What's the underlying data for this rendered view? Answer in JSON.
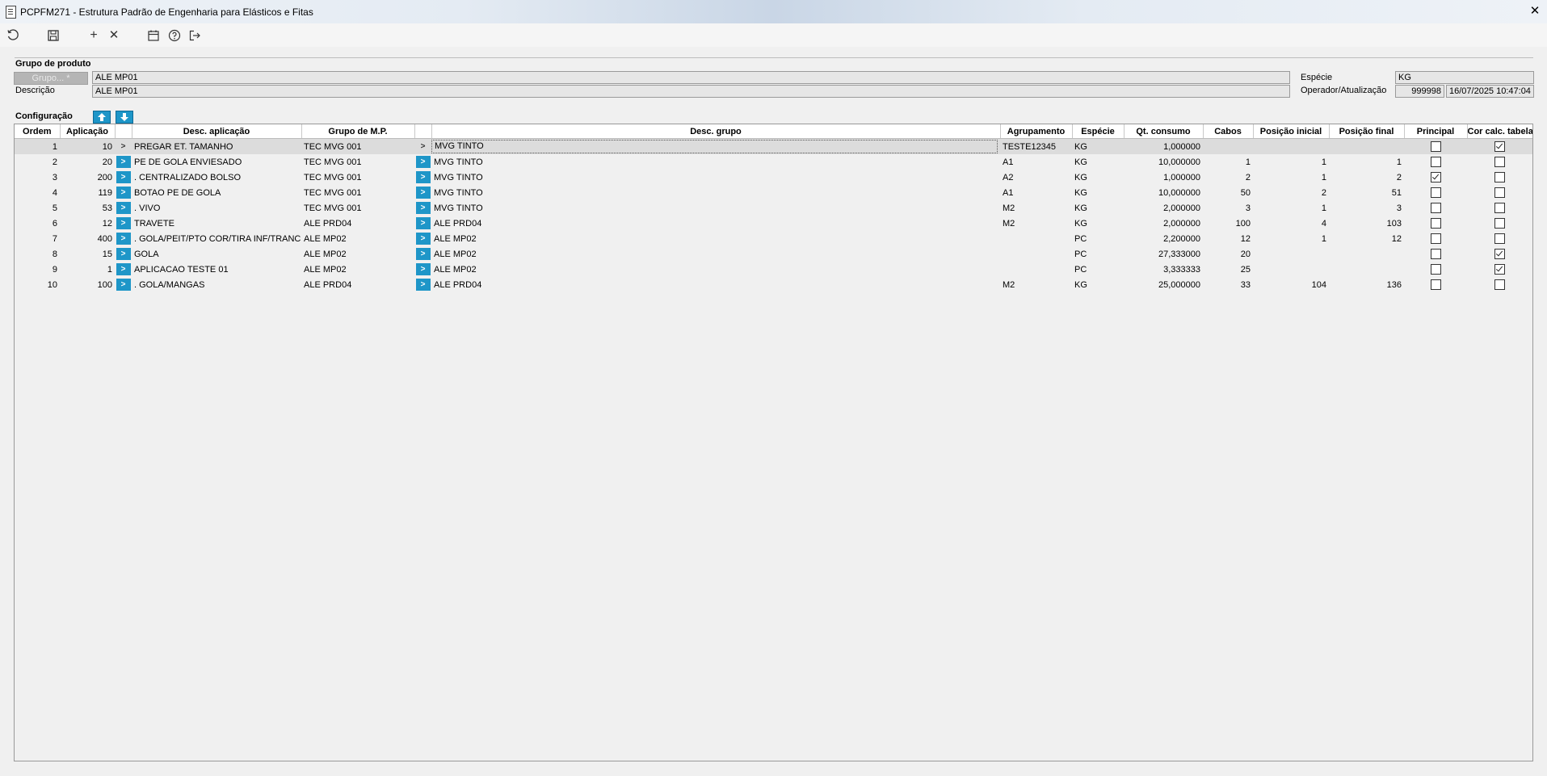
{
  "window": {
    "title": "PCPFM271 - Estrutura Padrão de Engenharia para Elásticos e Fitas",
    "close_glyph": "✕"
  },
  "toolbar": {
    "add_glyph": "+",
    "delete_glyph": "✕"
  },
  "header": {
    "section_label": "Grupo de produto",
    "grupo_button": "Grupo... *",
    "grupo_value": "ALE MP01",
    "descricao_label": "Descrição",
    "descricao_value": "ALE MP01",
    "especie_label": "Espécie",
    "especie_value": "KG",
    "operador_label": "Operador/Atualização",
    "operador_value": "999998",
    "atualizacao_value": "16/07/2025 10:47:04"
  },
  "config": {
    "label": "Configuração"
  },
  "grid": {
    "columns": [
      "Ordem",
      "Aplicação",
      "",
      "Desc. aplicação",
      "Grupo de M.P.",
      "",
      "Desc. grupo",
      "Agrupamento",
      "Espécie",
      "Qt. consumo",
      "Cabos",
      "Posição inicial",
      "Posição final",
      "Principal",
      "Cor calc. tabela"
    ],
    "row_button_label": ">",
    "rows": [
      {
        "ordem": "1",
        "aplicacao": "10",
        "desc_aplicacao": "PREGAR ET. TAMANHO",
        "grupo_mp": "TEC MVG 001",
        "desc_grupo": "MVG TINTO",
        "agrupamento": "TESTE12345",
        "especie": "KG",
        "qt_consumo": "1,000000",
        "cabos": "",
        "pos_inicial": "",
        "pos_final": "",
        "principal": false,
        "cor_calc": true,
        "selected": true
      },
      {
        "ordem": "2",
        "aplicacao": "20",
        "desc_aplicacao": "PE DE GOLA ENVIESADO",
        "grupo_mp": "TEC MVG 001",
        "desc_grupo": "MVG TINTO",
        "agrupamento": "A1",
        "especie": "KG",
        "qt_consumo": "10,000000",
        "cabos": "1",
        "pos_inicial": "1",
        "pos_final": "1",
        "principal": false,
        "cor_calc": false
      },
      {
        "ordem": "3",
        "aplicacao": "200",
        "desc_aplicacao": ". CENTRALIZADO BOLSO",
        "grupo_mp": "TEC MVG 001",
        "desc_grupo": "MVG TINTO",
        "agrupamento": "A2",
        "especie": "KG",
        "qt_consumo": "1,000000",
        "cabos": "2",
        "pos_inicial": "1",
        "pos_final": "2",
        "principal": true,
        "cor_calc": false
      },
      {
        "ordem": "4",
        "aplicacao": "119",
        "desc_aplicacao": "BOTAO PE DE GOLA",
        "grupo_mp": "TEC MVG 001",
        "desc_grupo": "MVG TINTO",
        "agrupamento": "A1",
        "especie": "KG",
        "qt_consumo": "10,000000",
        "cabos": "50",
        "pos_inicial": "2",
        "pos_final": "51",
        "principal": false,
        "cor_calc": false
      },
      {
        "ordem": "5",
        "aplicacao": "53",
        "desc_aplicacao": ". VIVO",
        "grupo_mp": "TEC MVG 001",
        "desc_grupo": "MVG TINTO",
        "agrupamento": "M2",
        "especie": "KG",
        "qt_consumo": "2,000000",
        "cabos": "3",
        "pos_inicial": "1",
        "pos_final": "3",
        "principal": false,
        "cor_calc": false
      },
      {
        "ordem": "6",
        "aplicacao": "12",
        "desc_aplicacao": "TRAVETE",
        "grupo_mp": "ALE PRD04",
        "desc_grupo": "ALE PRD04",
        "agrupamento": "M2",
        "especie": "KG",
        "qt_consumo": "2,000000",
        "cabos": "100",
        "pos_inicial": "4",
        "pos_final": "103",
        "principal": false,
        "cor_calc": false
      },
      {
        "ordem": "7",
        "aplicacao": "400",
        "desc_aplicacao": ". GOLA/PEIT/PTO COR/TIRA INF/TRANC PU",
        "grupo_mp": "ALE MP02",
        "desc_grupo": "ALE MP02",
        "agrupamento": "",
        "especie": "PC",
        "qt_consumo": "2,200000",
        "cabos": "12",
        "pos_inicial": "1",
        "pos_final": "12",
        "principal": false,
        "cor_calc": false
      },
      {
        "ordem": "8",
        "aplicacao": "15",
        "desc_aplicacao": "GOLA",
        "grupo_mp": "ALE MP02",
        "desc_grupo": "ALE MP02",
        "agrupamento": "",
        "especie": "PC",
        "qt_consumo": "27,333000",
        "cabos": "20",
        "pos_inicial": "",
        "pos_final": "",
        "principal": false,
        "cor_calc": true
      },
      {
        "ordem": "9",
        "aplicacao": "1",
        "desc_aplicacao": "APLICACAO TESTE 01",
        "grupo_mp": "ALE MP02",
        "desc_grupo": "ALE MP02",
        "agrupamento": "",
        "especie": "PC",
        "qt_consumo": "3,333333",
        "cabos": "25",
        "pos_inicial": "",
        "pos_final": "",
        "principal": false,
        "cor_calc": true
      },
      {
        "ordem": "10",
        "aplicacao": "100",
        "desc_aplicacao": ". GOLA/MANGAS",
        "grupo_mp": "ALE PRD04",
        "desc_grupo": "ALE PRD04",
        "agrupamento": "M2",
        "especie": "KG",
        "qt_consumo": "25,000000",
        "cabos": "33",
        "pos_inicial": "104",
        "pos_final": "136",
        "principal": false,
        "cor_calc": false
      }
    ]
  }
}
